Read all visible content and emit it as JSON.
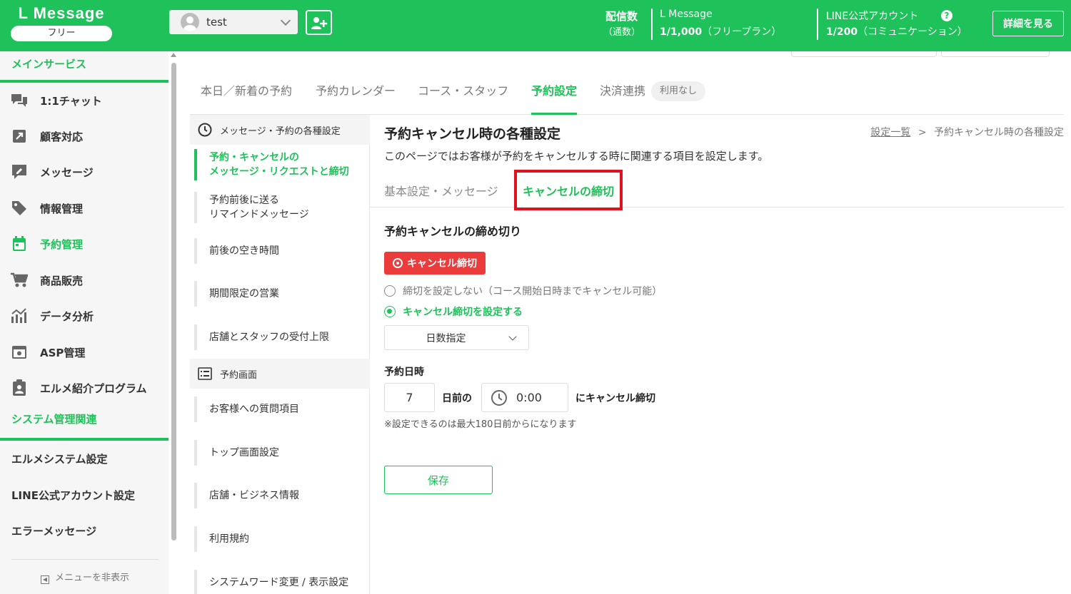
{
  "header": {
    "logo_text": "L Message",
    "plan_label": "フリー",
    "account_name": "test",
    "sent_label": "配信数",
    "sent_sublabel": "（通数）",
    "lmessage_label": "L Message",
    "lmessage_value": "1/1,000",
    "lmessage_plan": "（フリープラン）",
    "line_label": "LINE公式アカウント",
    "line_value": "1/200",
    "line_plan": "（コミュニケーション）",
    "help_label": "?",
    "detail_button": "詳細を見る"
  },
  "sidebar": {
    "section_main": "メインサービス",
    "items": [
      {
        "label": "1:1チャット",
        "icon": "chat-icon"
      },
      {
        "label": "顧客対応",
        "icon": "external-link-icon"
      },
      {
        "label": "メッセージ",
        "icon": "message-edit-icon"
      },
      {
        "label": "情報管理",
        "icon": "tag-icon"
      },
      {
        "label": "予約管理",
        "icon": "calendar-icon"
      },
      {
        "label": "商品販売",
        "icon": "cart-icon"
      },
      {
        "label": "データ分析",
        "icon": "chart-icon"
      },
      {
        "label": "ASP管理",
        "icon": "asp-icon"
      },
      {
        "label": "エルメ紹介プログラム",
        "icon": "clipboard-user-icon"
      }
    ],
    "section_system": "システム管理関連",
    "system_items": [
      "エルメシステム設定",
      "LINE公式アカウント設定",
      "エラーメッセージ"
    ],
    "hide_menu": "メニューを非表示"
  },
  "tabs": [
    "本日／新着の予約",
    "予約カレンダー",
    "コース・スタッフ",
    "予約設定",
    "決済連携"
  ],
  "tab_badge": "利用なし",
  "subnav": {
    "head1": "メッセージ・予約の各種設定",
    "active_item_line1": "予約・キャンセルの",
    "active_item_line2": "メッセージ・リクエストと締切",
    "remind_line1": "予約前後に送る",
    "remind_line2": "リマインドメッセージ",
    "items_a": [
      "前後の空き時間",
      "期間限定の営業",
      "店舗とスタッフの受付上限"
    ],
    "head2": "予約画面",
    "items_b": [
      "お客様への質問項目",
      "トップ画面設定",
      "店舗・ビジネス情報",
      "利用規約",
      "システムワード変更 / 表示設定"
    ]
  },
  "main": {
    "title": "予約キャンセル時の各種設定",
    "breadcrumb_link": "設定一覧",
    "breadcrumb_sep": ">",
    "breadcrumb_current": "予約キャンセル時の各種設定",
    "description": "このページではお客様が予約をキャンセルする時に関連する項目を設定します。",
    "subtab_basic": "基本設定・メッセージ",
    "subtab_cancel": "キャンセルの締切",
    "section_title": "予約キャンセルの締め切り",
    "red_tag": "キャンセル締切",
    "radio_no_deadline": "締切を設定しない（コース開始日時までキャンセル可能）",
    "radio_set_deadline": "キャンセル締切を設定する",
    "select_value": "日数指定",
    "field_label": "予約日時",
    "days_value": "7",
    "days_suffix": "日前の",
    "time_value": "0:00",
    "time_suffix": "にキャンセル締切",
    "note": "※設定できるのは最大180日前からになります",
    "save_button": "保存"
  },
  "colors": {
    "brand_green": "#1ec15a",
    "highlight_red": "#e0121f",
    "tag_red": "#ec3b3b"
  }
}
